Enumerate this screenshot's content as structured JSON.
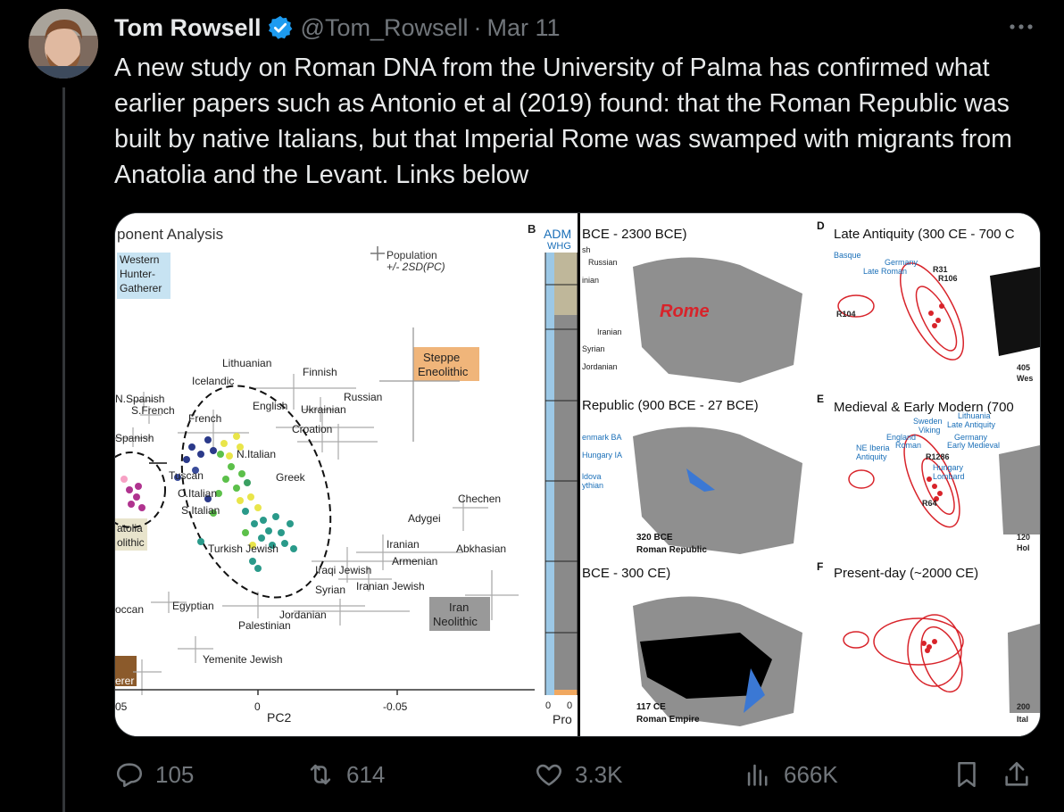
{
  "tweet": {
    "author_name": "Tom Rowsell",
    "handle": "@Tom_Rowsell",
    "separator": "·",
    "date": "Mar 11",
    "more_icon": "ellipsis-icon",
    "text": "A new study on Roman DNA from the University of Palma has confirmed what earlier papers such as Antonio et al (2019) found: that the Roman Republic was built by native Italians, but that Imperial Rome was swamped with migrants from Anatolia and the Levant. Links below"
  },
  "colors": {
    "background": "#000000",
    "text": "#e7e9ea",
    "muted": "#71767b",
    "verified": "#1d9bf0",
    "rome_red": "#d8232a",
    "arrow_blue": "#3b78d4"
  },
  "figure_left": {
    "title": "ponent Analysis",
    "legend_population": "Population",
    "legend_sd": "+/- 2SD(PC)",
    "panel_letter": "B",
    "adm_label": "ADM",
    "whg_label": "WHG",
    "pro_label": "Pro",
    "boxes": {
      "whg": [
        "Western",
        "Hunter-",
        "Gatherer"
      ],
      "steppe": [
        "Steppe",
        "Eneolithic"
      ],
      "anatolia": [
        "atolia",
        "olithic"
      ],
      "iran": [
        "Iran",
        "Neolithic"
      ],
      "hg": "erer"
    },
    "populations": [
      "Lithuanian",
      "Finnish",
      "Icelandic",
      "Russian",
      "N.Spanish",
      "S.French",
      "English",
      "Ukrainian",
      "French",
      "Croation",
      "Spanish",
      "N.Italian",
      "Tuscan",
      "Greek",
      "C.Italian",
      "S.Italian",
      "Chechen",
      "Adygei",
      "Iranian",
      "Abkhasian",
      "Armenian",
      "Turkish Jewish",
      "Iraqi Jewish",
      "Syrian",
      "Iranian Jewish",
      "Egyptian",
      "Jordanian",
      "Palestinian",
      "Yemenite Jewish",
      "occan"
    ],
    "axis_label": "PC2",
    "ticks": [
      "05",
      "0",
      "-0.05"
    ],
    "pro_ticks": [
      "0",
      "0"
    ]
  },
  "figure_right": {
    "panels": [
      {
        "title": "BCE - 2300 BCE)",
        "labels": [
          "sh",
          "Russian",
          "inian",
          "Iranian",
          "Syrian",
          "Jordanian"
        ],
        "map_label": "Rome"
      },
      {
        "letter": "D",
        "title": "Late Antiquity  (300 CE - 700 C",
        "labels": [
          "Basque",
          "Germany",
          "Late Roman",
          "R31",
          "R106",
          "R104"
        ],
        "corner": [
          "405",
          "Wes"
        ]
      },
      {
        "title": "Republic (900 BCE - 27 BCE)",
        "labels": [
          "enmark BA",
          "Hungary IA",
          "ldova",
          "ythian"
        ],
        "caption": [
          "320 BCE",
          "Roman Republic"
        ]
      },
      {
        "letter": "E",
        "title": "Medieval & Early Modern (700",
        "labels": [
          "Sweden",
          "Lithuania",
          "Late Antiquity",
          "Viking",
          "England",
          "Germany",
          "NE Iberia",
          "Roman",
          "Early Medieval",
          "Antiquity",
          "R1286",
          "Hungary",
          "Lombard",
          "R64"
        ],
        "corner": [
          "120",
          "Hol"
        ]
      },
      {
        "title": "BCE - 300 CE)",
        "caption": [
          "117 CE",
          "Roman Empire"
        ]
      },
      {
        "letter": "F",
        "title": "Present-day (~2000 CE)",
        "corner": [
          "200",
          "Ital"
        ]
      }
    ]
  },
  "actions": {
    "reply": {
      "icon": "reply-icon",
      "count": "105"
    },
    "retweet": {
      "icon": "retweet-icon",
      "count": "614"
    },
    "like": {
      "icon": "heart-icon",
      "count": "3.3K"
    },
    "views": {
      "icon": "views-chart-icon",
      "count": "666K"
    },
    "bookmark": {
      "icon": "bookmark-icon"
    },
    "share": {
      "icon": "share-icon"
    }
  }
}
